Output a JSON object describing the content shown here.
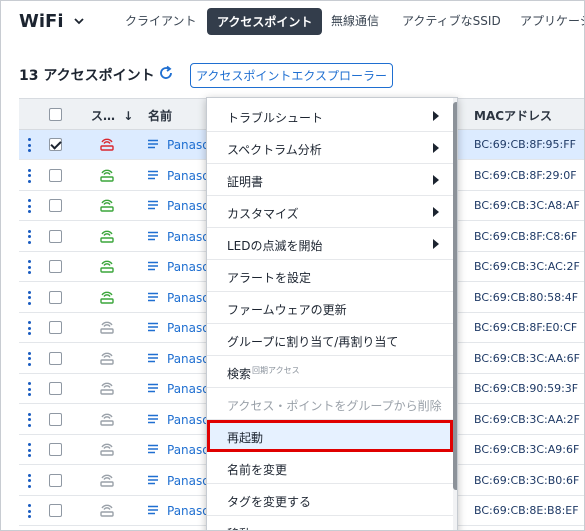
{
  "app": {
    "title": "WiFi"
  },
  "tabs": [
    {
      "label": "クライアント",
      "active": false
    },
    {
      "label": "アクセスポイント",
      "active": true
    },
    {
      "label": "無線通信",
      "active": false
    },
    {
      "label": "アクティブなSSID",
      "active": false
    },
    {
      "label": "アプリケーシ",
      "active": false
    }
  ],
  "header": {
    "count_title": "13 アクセスポイント",
    "explorer_button": "アクセスポイントエクスプローラー"
  },
  "table": {
    "columns": {
      "status": "ス…",
      "sort_arrow": "↓",
      "name": "名前",
      "mac": "MACアドレス"
    },
    "rows": [
      {
        "name": "Panaso",
        "mac": "BC:69:CB:8F:95:FF",
        "status": "red",
        "checked": true
      },
      {
        "name": "Panaso",
        "mac": "BC:69:CB:8F:29:0F",
        "status": "green",
        "checked": false
      },
      {
        "name": "Panaso",
        "mac": "BC:69:CB:3C:A8:AF",
        "status": "green",
        "checked": false
      },
      {
        "name": "Panaso",
        "mac": "BC:69:CB:8F:C8:6F",
        "status": "green",
        "checked": false
      },
      {
        "name": "Panaso",
        "mac": "BC:69:CB:3C:AC:2F",
        "status": "green",
        "checked": false
      },
      {
        "name": "Panaso",
        "mac": "BC:69:CB:80:58:4F",
        "status": "green",
        "checked": false
      },
      {
        "name": "Panaso",
        "mac": "BC:69:CB:8F:E0:CF",
        "status": "gray",
        "checked": false
      },
      {
        "name": "Panaso",
        "mac": "BC:69:CB:3C:AA:6F",
        "status": "gray",
        "checked": false
      },
      {
        "name": "Panaso",
        "mac": "BC:69:CB:90:59:3F",
        "status": "gray",
        "checked": false
      },
      {
        "name": "Panaso",
        "mac": "BC:69:CB:3C:AA:2F",
        "status": "gray",
        "checked": false
      },
      {
        "name": "Panaso",
        "mac": "BC:69:CB:3C:A9:6F",
        "status": "gray",
        "checked": false
      },
      {
        "name": "Panaso",
        "mac": "BC:69:CB:3C:B0:6F",
        "status": "gray",
        "checked": false
      },
      {
        "name": "Panaso",
        "mac": "BC:69:CB:8E:B8:EF",
        "status": "gray",
        "checked": false
      }
    ]
  },
  "context_menu": {
    "items": [
      {
        "label": "トラブルシュート",
        "submenu": true
      },
      {
        "label": "スペクトラム分析",
        "submenu": true
      },
      {
        "label": "証明書",
        "submenu": true
      },
      {
        "label": "カスタマイズ",
        "submenu": true
      },
      {
        "label": "LEDの点滅を開始",
        "submenu": true
      },
      {
        "label": "アラートを設定",
        "submenu": false
      },
      {
        "label": "ファームウェアの更新",
        "submenu": false
      },
      {
        "label": "グループに割り当て/再割り当て",
        "submenu": false
      },
      {
        "label": "検索",
        "sup": "回期アクセス",
        "submenu": false
      },
      {
        "label": "アクセス・ポイントをグループから削除",
        "submenu": false,
        "disabled": true
      },
      {
        "label": "再起動",
        "submenu": false,
        "highlight": true
      },
      {
        "label": "名前を変更",
        "submenu": false
      },
      {
        "label": "タグを変更する",
        "submenu": false
      },
      {
        "label": "移動",
        "submenu": false
      }
    ]
  },
  "colors": {
    "accent": "#1f6fd1",
    "status_red": "#d9262e",
    "status_green": "#3aa53a",
    "status_gray": "#9aa1a9",
    "highlight_border": "#e00000"
  }
}
